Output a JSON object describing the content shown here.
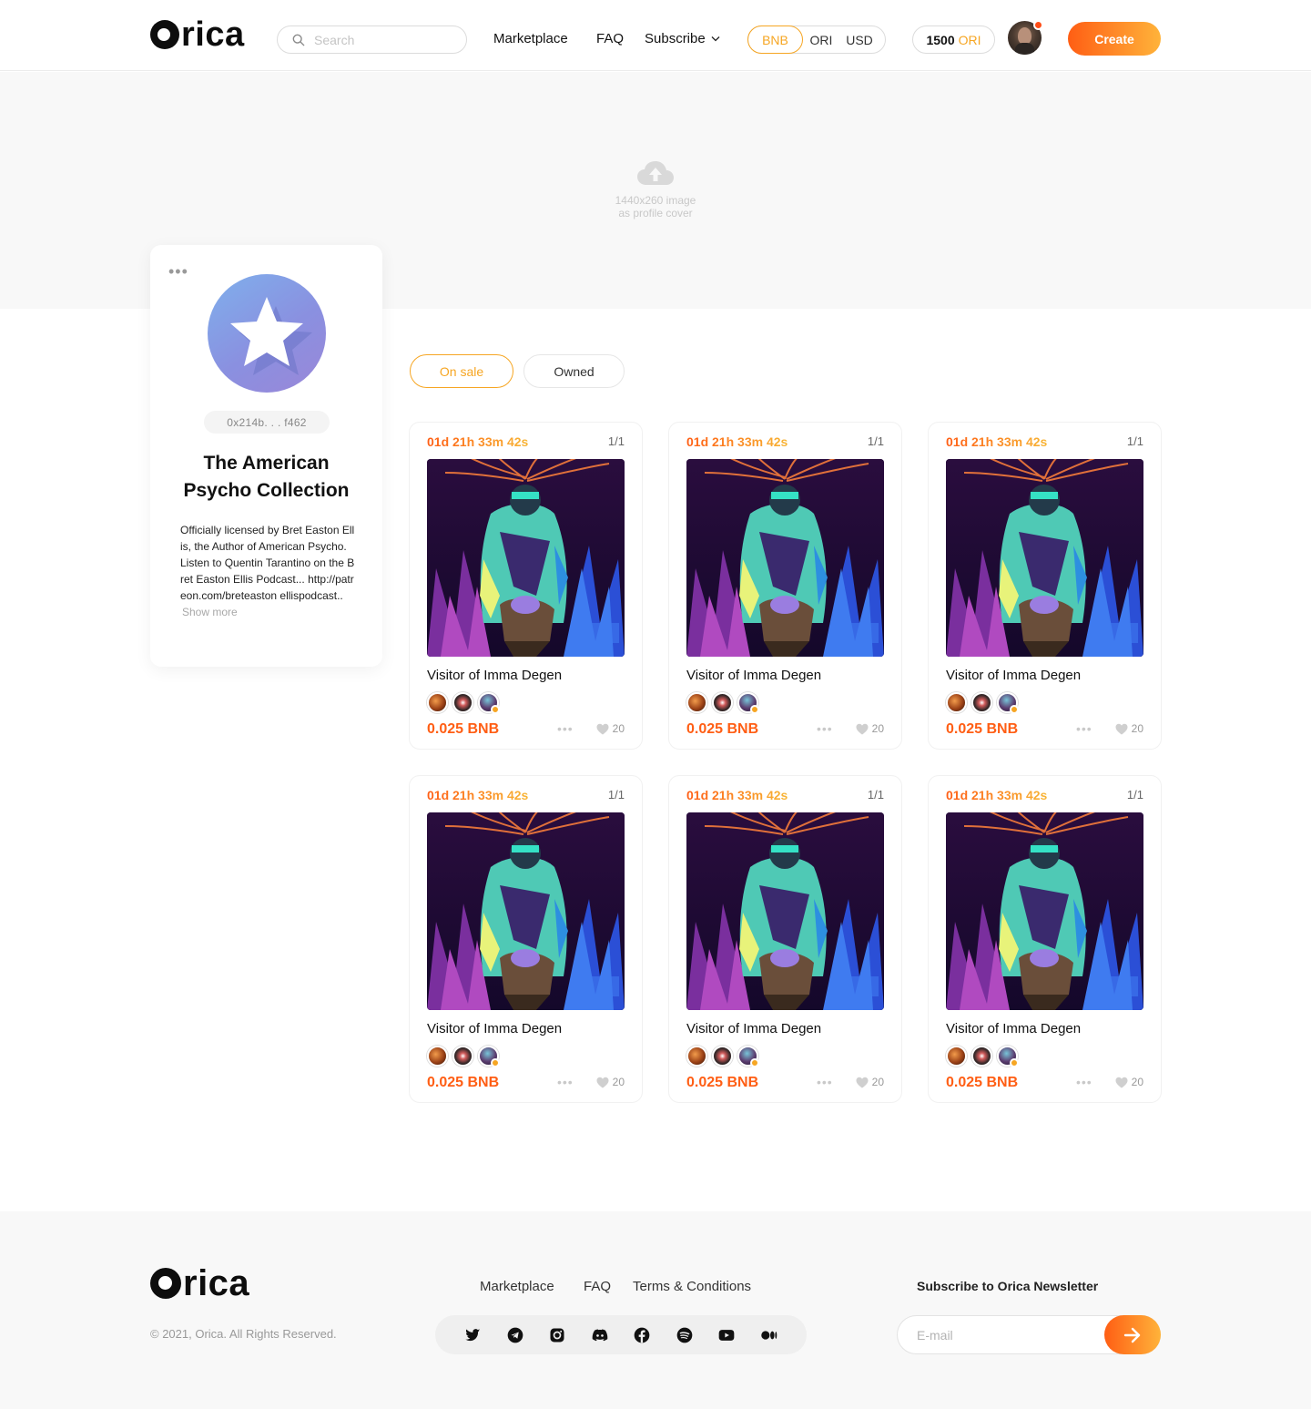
{
  "header": {
    "logo": "rica",
    "search_placeholder": "Search",
    "nav": {
      "marketplace": "Marketplace",
      "faq": "FAQ",
      "subscribe": "Subscribe"
    },
    "currencies": [
      "BNB",
      "ORI",
      "USD"
    ],
    "active_currency": "BNB",
    "balance": {
      "amount": "1500",
      "unit": "ORI"
    },
    "create_label": "Create"
  },
  "cover": {
    "hint_line1": "1440x260 image",
    "hint_line2": "as profile cover"
  },
  "profile": {
    "more": "•••",
    "address": "0x214b. . . f462",
    "name": "The American Psycho Collection",
    "description": "Officially licensed by Bret Easton Ellis, the Author of American Psycho. Listen to Quentin Tarantino on the Bret Easton Ellis Podcast... http://patreon.com/breteaston ellispodcast..",
    "show_more": "Show more"
  },
  "tabs": {
    "on_sale": "On sale",
    "owned": "Owned"
  },
  "cards": [
    {
      "timer": "01d 21h 33m 42s",
      "edition": "1/1",
      "title": "Visitor of Imma Degen",
      "price": "0.025 BNB",
      "more": "•••",
      "likes": "20"
    },
    {
      "timer": "01d 21h 33m 42s",
      "edition": "1/1",
      "title": "Visitor of Imma Degen",
      "price": "0.025 BNB",
      "more": "•••",
      "likes": "20"
    },
    {
      "timer": "01d 21h 33m 42s",
      "edition": "1/1",
      "title": "Visitor of Imma Degen",
      "price": "0.025 BNB",
      "more": "•••",
      "likes": "20"
    },
    {
      "timer": "01d 21h 33m 42s",
      "edition": "1/1",
      "title": "Visitor of Imma Degen",
      "price": "0.025 BNB",
      "more": "•••",
      "likes": "20"
    },
    {
      "timer": "01d 21h 33m 42s",
      "edition": "1/1",
      "title": "Visitor of Imma Degen",
      "price": "0.025 BNB",
      "more": "•••",
      "likes": "20"
    },
    {
      "timer": "01d 21h 33m 42s",
      "edition": "1/1",
      "title": "Visitor of Imma Degen",
      "price": "0.025 BNB",
      "more": "•••",
      "likes": "20"
    }
  ],
  "footer": {
    "logo": "rica",
    "copyright": "© 2021, Orica. All Rights Reserved.",
    "nav": {
      "marketplace": "Marketplace",
      "faq": "FAQ",
      "terms": "Terms & Conditions"
    },
    "socials": [
      "twitter-icon",
      "telegram-icon",
      "instagram-icon",
      "discord-icon",
      "facebook-icon",
      "spotify-icon",
      "youtube-icon",
      "medium-icon"
    ],
    "newsletter_title": "Subscribe to Orica Newsletter",
    "email_placeholder": "E-mail"
  },
  "colors": {
    "accent_orange": "#ff5e14",
    "accent_yellow": "#f6a623",
    "page_bg_muted": "#f8f8f8"
  }
}
